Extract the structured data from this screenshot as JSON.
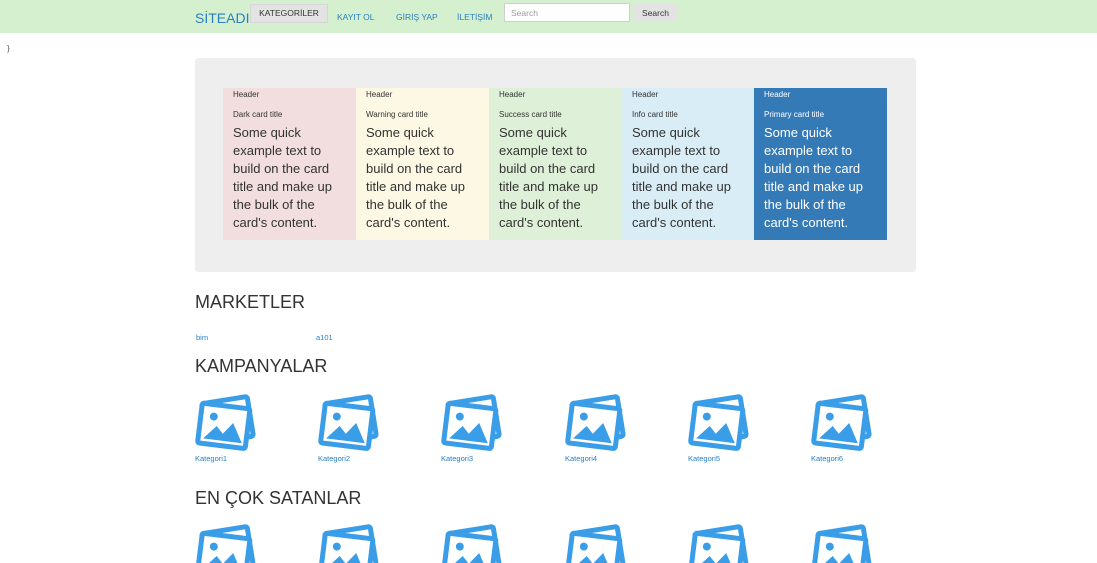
{
  "navbar": {
    "brand": "SİTEADI",
    "active_item": "KATEGORİLER",
    "links": [
      "KAYIT OL",
      "GİRİŞ YAP",
      "İLETİŞİM"
    ],
    "search_placeholder": "Search",
    "search_button": "Search"
  },
  "stray_text": "}",
  "cards": [
    {
      "header": "Header",
      "title": "Dark card title",
      "text": "Some quick example text to build on the card title and make up the bulk of the card's content."
    },
    {
      "header": "Header",
      "title": "Warning card title",
      "text": "Some quick example text to build on the card title and make up the bulk of the card's content."
    },
    {
      "header": "Header",
      "title": "Success card title",
      "text": "Some quick example text to build on the card title and make up the bulk of the card's content."
    },
    {
      "header": "Header",
      "title": "Info card title",
      "text": "Some quick example text to build on the card title and make up the bulk of the card's content."
    },
    {
      "header": "Header",
      "title": "Primary card title",
      "text": "Some quick example text to build on the card title and make up the bulk of the card's content."
    }
  ],
  "markets": {
    "heading": "MARKETLER",
    "links": [
      "bim",
      "a101"
    ]
  },
  "campaigns": {
    "heading": "KAMPANYALAR",
    "items": [
      "Kategori1",
      "Kategori2",
      "Kategori3",
      "Kategori4",
      "Kategori5",
      "Kategori6"
    ]
  },
  "bestsellers": {
    "heading": "EN ÇOK SATANLAR"
  },
  "colors": {
    "navbar_bg": "#d5f0cf",
    "link": "#2a7fc4",
    "image_icon": "#3a9de8",
    "primary": "#337ab7"
  }
}
